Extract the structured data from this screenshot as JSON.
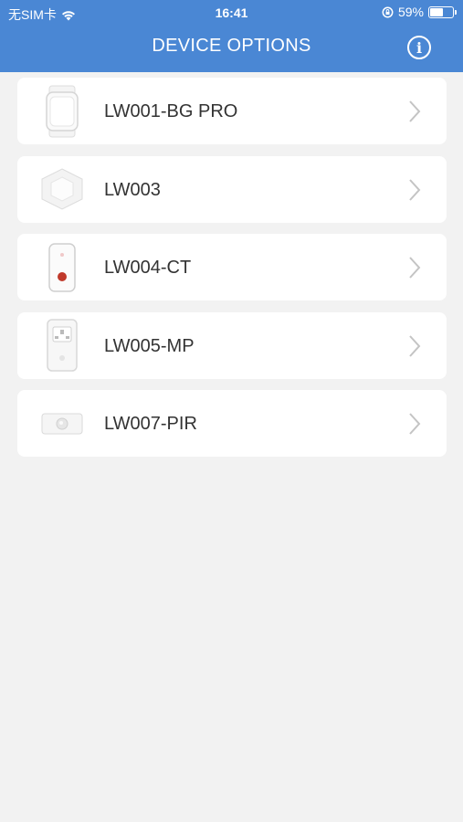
{
  "status_bar": {
    "carrier": "无SIM卡",
    "time": "16:41",
    "battery": "59%",
    "battery_level": 0.59
  },
  "header": {
    "title": "DEVICE OPTIONS",
    "info_icon": "info-icon",
    "background_color": "#4a87d4"
  },
  "devices": [
    {
      "name": "LW001-BG PRO",
      "icon": "wristband-device-icon"
    },
    {
      "name": "LW003",
      "icon": "hexagon-device-icon"
    },
    {
      "name": "LW004-CT",
      "icon": "card-tag-device-icon"
    },
    {
      "name": "LW005-MP",
      "icon": "smart-plug-device-icon"
    },
    {
      "name": "LW007-PIR",
      "icon": "pir-sensor-device-icon"
    }
  ]
}
